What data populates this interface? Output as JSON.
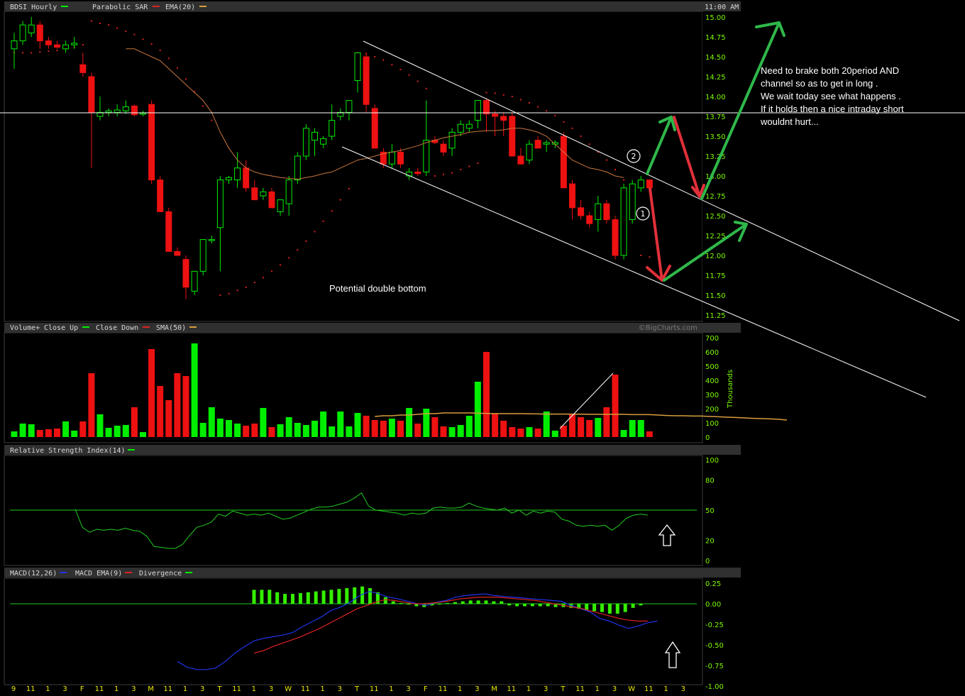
{
  "header": {
    "symbol_label": "BDSI Hourly",
    "indicator1": "Parabolic SAR",
    "indicator2": "EMA(20)",
    "time": "11:00 AM",
    "watermark": "©BigCharts.com"
  },
  "colors": {
    "up": "#00ee00",
    "down": "#ee1111",
    "ema": "#c8763c",
    "sar": "#dd2222",
    "sma": "#d79d3c",
    "rsi": "#22cc22",
    "macd": "#2233ee",
    "macd_ema": "#dd2222",
    "hist": "#33ee00",
    "axis_text": "#7CFC00",
    "x_text": "#e8e800"
  },
  "chart_data": [
    {
      "type": "candlestick",
      "title": "BDSI Hourly",
      "series_names": [
        "Parabolic SAR",
        "EMA(20)"
      ],
      "y_ticks": [
        15.0,
        14.75,
        14.5,
        14.25,
        14.0,
        13.75,
        13.5,
        13.25,
        13.0,
        12.75,
        12.5,
        12.25,
        12.0,
        11.75,
        11.5,
        11.25
      ],
      "y_tick_labels": [
        "15.00",
        "14.75",
        "14.50",
        "14.25",
        "14.00",
        "13.75",
        "13.50",
        "13.25",
        "13.00",
        "12.75",
        "12.50",
        "12.25",
        "12.00",
        "11.75",
        "11.50",
        "11.25"
      ],
      "ylim": [
        11.25,
        15.0
      ],
      "candles": [
        [
          14.6,
          14.8,
          14.35,
          14.7
        ],
        [
          14.7,
          14.95,
          14.65,
          14.9
        ],
        [
          14.8,
          15.0,
          14.75,
          14.9
        ],
        [
          14.9,
          14.95,
          14.6,
          14.7
        ],
        [
          14.7,
          14.75,
          14.6,
          14.65
        ],
        [
          14.65,
          14.7,
          14.6,
          14.62
        ],
        [
          14.6,
          14.7,
          14.55,
          14.65
        ],
        [
          14.65,
          14.75,
          14.6,
          14.67
        ],
        [
          14.4,
          14.55,
          14.25,
          14.3
        ],
        [
          14.25,
          14.3,
          13.1,
          13.8
        ],
        [
          13.75,
          14.0,
          13.7,
          13.8
        ],
        [
          13.8,
          13.85,
          13.75,
          13.82
        ],
        [
          13.8,
          13.9,
          13.75,
          13.83
        ],
        [
          13.82,
          13.95,
          13.78,
          13.87
        ],
        [
          13.88,
          13.9,
          13.75,
          13.77
        ],
        [
          13.78,
          13.82,
          13.75,
          13.79
        ],
        [
          13.9,
          13.95,
          12.9,
          12.95
        ],
        [
          12.95,
          13.0,
          12.55,
          12.55
        ],
        [
          12.55,
          12.6,
          12.05,
          12.05
        ],
        [
          12.05,
          12.1,
          12.0,
          12.0
        ],
        [
          11.95,
          12.0,
          11.45,
          11.6
        ],
        [
          11.55,
          11.8,
          11.5,
          11.8
        ],
        [
          11.8,
          12.2,
          11.75,
          12.2
        ],
        [
          12.2,
          12.25,
          12.15,
          12.2
        ],
        [
          12.35,
          13.0,
          11.8,
          12.95
        ],
        [
          12.95,
          13.0,
          12.9,
          12.98
        ],
        [
          12.95,
          13.3,
          12.85,
          13.1
        ],
        [
          13.1,
          13.2,
          12.8,
          12.85
        ],
        [
          12.85,
          12.95,
          12.7,
          12.7
        ],
        [
          12.75,
          12.85,
          12.7,
          12.8
        ],
        [
          12.8,
          12.85,
          12.6,
          12.6
        ],
        [
          12.55,
          12.7,
          12.5,
          12.7
        ],
        [
          12.65,
          13.0,
          12.5,
          12.95
        ],
        [
          12.95,
          13.3,
          12.9,
          13.25
        ],
        [
          13.25,
          13.65,
          13.2,
          13.6
        ],
        [
          13.45,
          13.6,
          13.25,
          13.55
        ],
        [
          13.4,
          13.5,
          13.35,
          13.47
        ],
        [
          13.5,
          13.9,
          13.45,
          13.7
        ],
        [
          13.75,
          13.85,
          13.7,
          13.8
        ],
        [
          13.8,
          13.95,
          13.7,
          13.95
        ],
        [
          14.2,
          14.55,
          14.05,
          14.55
        ],
        [
          14.5,
          14.55,
          13.8,
          13.9
        ],
        [
          13.85,
          13.9,
          13.35,
          13.35
        ],
        [
          13.3,
          13.35,
          13.1,
          13.15
        ],
        [
          13.15,
          13.4,
          13.1,
          13.3
        ],
        [
          13.3,
          13.35,
          13.1,
          13.15
        ],
        [
          13.0,
          13.1,
          12.95,
          13.05
        ],
        [
          13.05,
          13.1,
          13.0,
          13.03
        ],
        [
          13.05,
          13.95,
          13.0,
          13.45
        ],
        [
          13.45,
          13.5,
          13.4,
          13.42
        ],
        [
          13.4,
          13.45,
          13.25,
          13.3
        ],
        [
          13.35,
          13.6,
          13.25,
          13.55
        ],
        [
          13.55,
          13.7,
          13.5,
          13.65
        ],
        [
          13.6,
          13.7,
          13.55,
          13.65
        ],
        [
          13.7,
          13.95,
          13.6,
          13.95
        ],
        [
          13.95,
          13.98,
          13.55,
          13.78
        ],
        [
          13.78,
          13.82,
          13.5,
          13.75
        ],
        [
          13.75,
          13.8,
          13.5,
          13.7
        ],
        [
          13.75,
          13.8,
          13.25,
          13.25
        ],
        [
          13.25,
          13.35,
          13.15,
          13.15
        ],
        [
          13.2,
          13.45,
          13.15,
          13.4
        ],
        [
          13.45,
          13.5,
          13.35,
          13.35
        ],
        [
          13.4,
          13.45,
          13.3,
          13.42
        ],
        [
          13.4,
          13.45,
          13.35,
          13.42
        ],
        [
          13.5,
          13.55,
          12.85,
          12.85
        ],
        [
          12.9,
          12.95,
          12.45,
          12.6
        ],
        [
          12.6,
          12.7,
          12.45,
          12.5
        ],
        [
          12.5,
          12.55,
          12.35,
          12.4
        ],
        [
          12.45,
          12.75,
          12.3,
          12.65
        ],
        [
          12.65,
          12.7,
          12.4,
          12.45
        ],
        [
          12.45,
          12.5,
          11.95,
          12.0
        ],
        [
          12.0,
          12.9,
          11.95,
          12.85
        ],
        [
          12.45,
          12.95,
          12.4,
          12.9
        ],
        [
          12.85,
          13.0,
          12.8,
          12.95
        ],
        [
          12.95,
          12.95,
          12.85,
          12.85
        ]
      ],
      "ema": [
        14.6,
        14.6,
        14.55,
        14.5,
        14.45,
        14.35,
        14.25,
        14.15,
        14.05,
        13.95,
        13.8,
        13.55,
        13.35,
        13.2,
        13.1,
        13.05,
        13.02,
        13.0,
        12.98,
        12.97,
        12.96,
        12.98,
        13.0,
        13.03,
        13.05,
        13.1,
        13.15,
        13.2,
        13.22,
        13.25,
        13.28,
        13.3,
        13.32,
        13.35,
        13.38,
        13.42,
        13.45,
        13.48,
        13.5,
        13.52,
        13.55,
        13.56,
        13.57,
        13.57,
        13.58,
        13.6,
        13.6,
        13.58,
        13.55,
        13.5,
        13.4,
        13.3,
        13.2,
        13.15,
        13.1,
        13.08,
        13.05,
        13.0,
        12.98
      ],
      "ema_start": 13,
      "sar": [
        14.55,
        14.55,
        14.55,
        14.56,
        14.57,
        14.58,
        14.6,
        14.62,
        14.65,
        14.95,
        14.92,
        14.9,
        14.86,
        14.82,
        14.78,
        14.72,
        14.66,
        14.58,
        14.48,
        14.36,
        14.22,
        14.06,
        13.88,
        13.7,
        11.5,
        11.52,
        11.56,
        11.6,
        11.66,
        11.72,
        11.8,
        11.88,
        11.97,
        12.07,
        12.18,
        12.3,
        12.43,
        12.56,
        12.7,
        12.84,
        14.55,
        14.54,
        14.5,
        14.46,
        14.4,
        14.34,
        14.27,
        14.19,
        14.1,
        13.0,
        13.02,
        13.04,
        13.08,
        13.12,
        13.16,
        14.05,
        14.04,
        14.02,
        14.0,
        13.96,
        13.92,
        13.87,
        13.82,
        13.76,
        13.68,
        13.6,
        13.5,
        13.4,
        13.3,
        13.2,
        13.08,
        12.95,
        12.82,
        12.0,
        11.98
      ]
    },
    {
      "type": "bar",
      "title": "Volume+",
      "series_names": [
        "Close Up",
        "Close Down",
        "SMA(50)"
      ],
      "y_ticks": [
        0,
        100,
        200,
        300,
        400,
        500,
        600,
        700
      ],
      "y_tick_labels": [
        "0",
        "100",
        "200",
        "300",
        "400",
        "500",
        "600",
        "700"
      ],
      "ylabel": "Thousands",
      "ylim": [
        0,
        700
      ],
      "values": [
        40,
        95,
        90,
        50,
        55,
        60,
        110,
        45,
        110,
        450,
        160,
        65,
        80,
        85,
        210,
        35,
        620,
        360,
        260,
        450,
        430,
        660,
        100,
        210,
        130,
        120,
        95,
        80,
        95,
        205,
        70,
        90,
        140,
        100,
        85,
        115,
        180,
        75,
        180,
        75,
        170,
        150,
        120,
        115,
        130,
        115,
        205,
        95,
        200,
        140,
        75,
        70,
        85,
        150,
        390,
        600,
        165,
        115,
        70,
        60,
        70,
        60,
        180,
        45,
        80,
        160,
        140,
        120,
        135,
        210,
        440,
        50,
        120,
        120,
        40
      ],
      "sma": [
        145,
        150,
        150,
        155,
        155,
        160,
        165,
        165,
        170,
        170,
        170,
        170,
        168,
        166,
        165,
        165,
        165,
        165,
        164,
        163,
        162,
        162,
        162,
        161,
        161,
        160,
        160,
        160,
        160,
        160,
        158,
        158,
        158,
        155,
        152,
        150,
        150,
        148,
        148,
        145,
        143,
        140,
        138,
        135,
        132,
        130,
        128,
        125,
        120
      ],
      "sma_start": 42
    },
    {
      "type": "line",
      "title": "Relative Strength Index(14)",
      "y_ticks": [
        0,
        20,
        50,
        80,
        100
      ],
      "y_tick_labels": [
        "0",
        "20",
        "50",
        "80",
        "100"
      ],
      "ylim": [
        0,
        100
      ],
      "reference": 50,
      "values": [
        51,
        33,
        28,
        31,
        30,
        31,
        30,
        32,
        30,
        29,
        24,
        14,
        13,
        12,
        12,
        16,
        25,
        33,
        35,
        38,
        46,
        44,
        49,
        47,
        45,
        46,
        45,
        47,
        44,
        41,
        42,
        45,
        48,
        51,
        53,
        53,
        54,
        56,
        58,
        62,
        67,
        54,
        50,
        49,
        48,
        47,
        45,
        47,
        46,
        47,
        52,
        53,
        52,
        52,
        53,
        57,
        54,
        52,
        51,
        50,
        52,
        47,
        50,
        45,
        49,
        47,
        49,
        48,
        41,
        39,
        35,
        34,
        35,
        34,
        35,
        30,
        35,
        42,
        45,
        46,
        45
      ]
    },
    {
      "type": "line",
      "title": "MACD(12,26)",
      "series_names": [
        "MACD",
        "MACD EMA(9)",
        "Divergence"
      ],
      "y_ticks": [
        0.25,
        0.0,
        -0.25,
        -0.5,
        -0.75,
        -1.0
      ],
      "y_tick_labels": [
        "0.25",
        "0.00",
        "-0.25",
        "-0.50",
        "-0.75",
        "-1.00"
      ],
      "ylim": [
        -1.0,
        0.25
      ],
      "macd": [
        -0.7,
        -0.77,
        -0.8,
        -0.8,
        -0.78,
        -0.7,
        -0.6,
        -0.52,
        -0.45,
        -0.42,
        -0.4,
        -0.38,
        -0.35,
        -0.28,
        -0.22,
        -0.16,
        -0.08,
        -0.04,
        0.02,
        0.1,
        0.15,
        0.12,
        0.08,
        0.06,
        0.03,
        0.0,
        -0.02,
        0.02,
        0.04,
        0.08,
        0.1,
        0.11,
        0.12,
        0.1,
        0.09,
        0.08,
        0.07,
        0.06,
        0.05,
        0.04,
        0.03,
        -0.02,
        -0.06,
        -0.1,
        -0.18,
        -0.21,
        -0.26,
        -0.3,
        -0.27,
        -0.23,
        -0.21
      ],
      "macd_start": 20,
      "signal": [
        -0.6,
        -0.57,
        -0.52,
        -0.48,
        -0.44,
        -0.4,
        -0.35,
        -0.3,
        -0.24,
        -0.18,
        -0.12,
        -0.06,
        -0.02,
        0.02,
        0.05,
        0.04,
        0.02,
        0.0,
        0.0,
        0.01,
        0.02,
        0.04,
        0.06,
        0.07,
        0.08,
        0.08,
        0.08,
        0.07,
        0.06,
        0.05,
        0.04,
        0.02,
        0.0,
        -0.02,
        -0.04,
        -0.06,
        -0.09,
        -0.12,
        -0.15,
        -0.18,
        -0.2,
        -0.21,
        -0.21
      ],
      "signal_start": 29,
      "hist_values": [
        0.17,
        0.17,
        0.17,
        0.14,
        0.12,
        0.12,
        0.13,
        0.14,
        0.15,
        0.16,
        0.17,
        0.18,
        0.19,
        0.2,
        0.21,
        0.19,
        0.14,
        0.08,
        0.03,
        0.01,
        -0.01,
        -0.03,
        -0.04,
        -0.02,
        0.0,
        0.01,
        0.02,
        0.03,
        0.04,
        0.04,
        0.04,
        0.03,
        0.03,
        -0.02,
        -0.03,
        -0.03,
        -0.03,
        -0.03,
        -0.03,
        -0.04,
        -0.04,
        -0.05,
        -0.06,
        -0.08,
        -0.09,
        -0.1,
        -0.12,
        -0.12,
        -0.1,
        -0.05,
        -0.02
      ],
      "hist_start": 28
    }
  ],
  "x_axis": {
    "labels": [
      "9",
      "11",
      "1",
      "3",
      "F",
      "11",
      "1",
      "3",
      "M",
      "11",
      "1",
      "3",
      "T",
      "11",
      "1",
      "3",
      "W",
      "11",
      "1",
      "3",
      "T",
      "11",
      "1",
      "3",
      "F",
      "11",
      "1",
      "3",
      "M",
      "11",
      "1",
      "3",
      "T",
      "11",
      "1",
      "3",
      "W",
      "11",
      "1",
      "3"
    ]
  },
  "annotations": {
    "double_bottom": "Potential double bottom",
    "note": [
      "Need to brake both 20period AND",
      "channel so as to get in long .",
      "We wait today see what happens .",
      "If it holds then a nice intraday short",
      "wouldnt hurt..."
    ],
    "marker1": "1",
    "marker2": "2"
  }
}
